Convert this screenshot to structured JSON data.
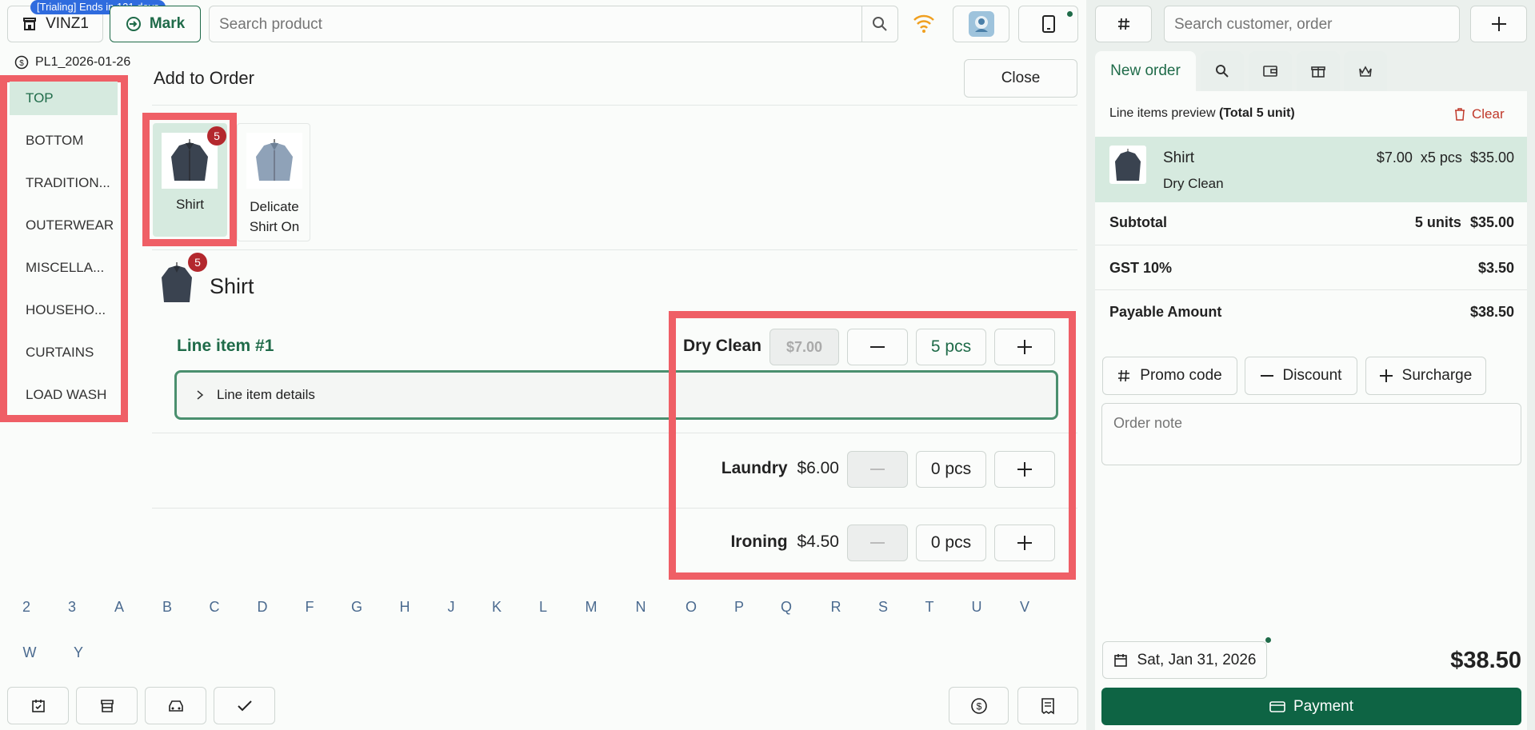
{
  "header": {
    "trial_badge": "[Trialing] Ends in 121 days",
    "store_name": "VINZ1",
    "mark_label": "Mark",
    "search_placeholder": "Search product",
    "price_list": "PL1_2026-01-26"
  },
  "categories": [
    "TOP",
    "BOTTOM",
    "TRADITION...",
    "OUTERWEAR",
    "MISCELLA...",
    "HOUSEHO...",
    "CURTAINS",
    "LOAD WASH"
  ],
  "add_to_order": {
    "title": "Add to Order",
    "close_label": "Close",
    "products": [
      {
        "name": "Shirt",
        "badge": "5"
      },
      {
        "name": "Delicate Shirt On",
        "badge": ""
      }
    ],
    "selected_product": {
      "name": "Shirt",
      "badge": "5"
    },
    "line_item_title": "Line item #1",
    "line_item_details": "Line item details",
    "services": [
      {
        "name": "Dry Clean",
        "price": "$7.00",
        "qty": "5 pcs"
      },
      {
        "name": "Laundry",
        "price": "$6.00",
        "qty": "0 pcs"
      },
      {
        "name": "Ironing",
        "price": "$4.50",
        "qty": "0 pcs"
      }
    ]
  },
  "alphabet": [
    "2",
    "3",
    "A",
    "B",
    "C",
    "D",
    "F",
    "G",
    "H",
    "J",
    "K",
    "L",
    "M",
    "N",
    "O",
    "P",
    "Q",
    "R",
    "S",
    "T",
    "U",
    "V",
    "W",
    "Y"
  ],
  "right": {
    "customer_search_placeholder": "Search customer, order",
    "tab_new_order": "New order",
    "preview_label": "Line items preview",
    "preview_total": "(Total 5 unit)",
    "clear_label": "Clear",
    "line": {
      "name": "Shirt",
      "service": "Dry Clean",
      "unit_price": "$7.00",
      "qty": "x5 pcs",
      "total": "$35.00"
    },
    "subtotal_label": "Subtotal",
    "subtotal_units": "5 units",
    "subtotal_value": "$35.00",
    "gst_label": "GST 10%",
    "gst_value": "$3.50",
    "payable_label": "Payable Amount",
    "payable_value": "$38.50",
    "promo_label": "Promo code",
    "discount_label": "Discount",
    "surcharge_label": "Surcharge",
    "note_placeholder": "Order note",
    "date": "Sat, Jan 31, 2026",
    "grand_total": "$38.50",
    "payment_label": "Payment"
  },
  "colors": {
    "accent": "#1f6b49",
    "payment": "#0e6444",
    "selected_bg": "#d6eadf",
    "badge": "#b3282d",
    "highlight": "#ef5f66",
    "wifi": "#f0a020",
    "clear": "#c0392b"
  }
}
